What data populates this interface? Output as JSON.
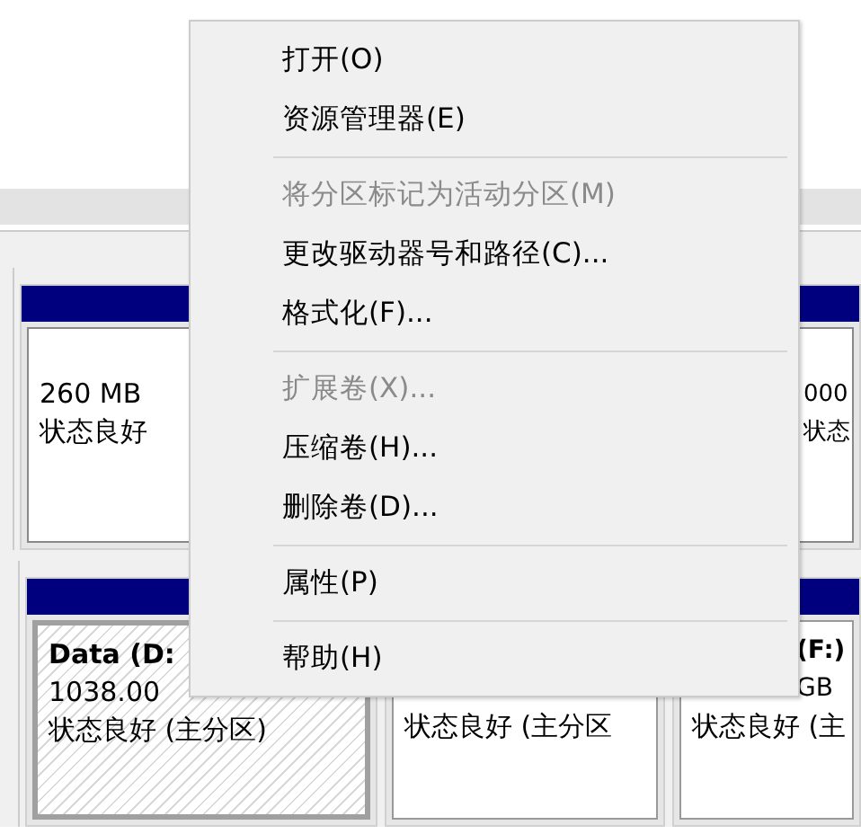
{
  "disks": [
    {
      "partitions": [
        {
          "lines": [
            "260 MB",
            "状态良好"
          ]
        },
        {
          "lines": [
            "000",
            "状态"
          ]
        }
      ]
    },
    {
      "partitions": [
        {
          "title": "Data  (D:",
          "lines": [
            "1038.00",
            "状态良好 (主分区)"
          ]
        },
        {
          "lines": [
            "状态良好 (主分区"
          ]
        },
        {
          "title": "(F:)",
          "lines": [
            "GB",
            "状态良好 (主"
          ]
        }
      ]
    }
  ],
  "menu": {
    "items": [
      {
        "kind": "item",
        "label": "打开(O)",
        "disabled": false
      },
      {
        "kind": "item",
        "label": "资源管理器(E)",
        "disabled": false
      },
      {
        "kind": "separator"
      },
      {
        "kind": "item",
        "label": "将分区标记为活动分区(M)",
        "disabled": true
      },
      {
        "kind": "item",
        "label": "更改驱动器号和路径(C)...",
        "disabled": false
      },
      {
        "kind": "item",
        "label": "格式化(F)...",
        "disabled": false
      },
      {
        "kind": "separator"
      },
      {
        "kind": "item",
        "label": "扩展卷(X)...",
        "disabled": true
      },
      {
        "kind": "item",
        "label": "压缩卷(H)...",
        "disabled": false
      },
      {
        "kind": "item",
        "label": "删除卷(D)...",
        "disabled": false
      },
      {
        "kind": "separator"
      },
      {
        "kind": "item",
        "label": "属性(P)",
        "disabled": false
      },
      {
        "kind": "separator"
      },
      {
        "kind": "item",
        "label": "帮助(H)",
        "disabled": false
      }
    ]
  }
}
